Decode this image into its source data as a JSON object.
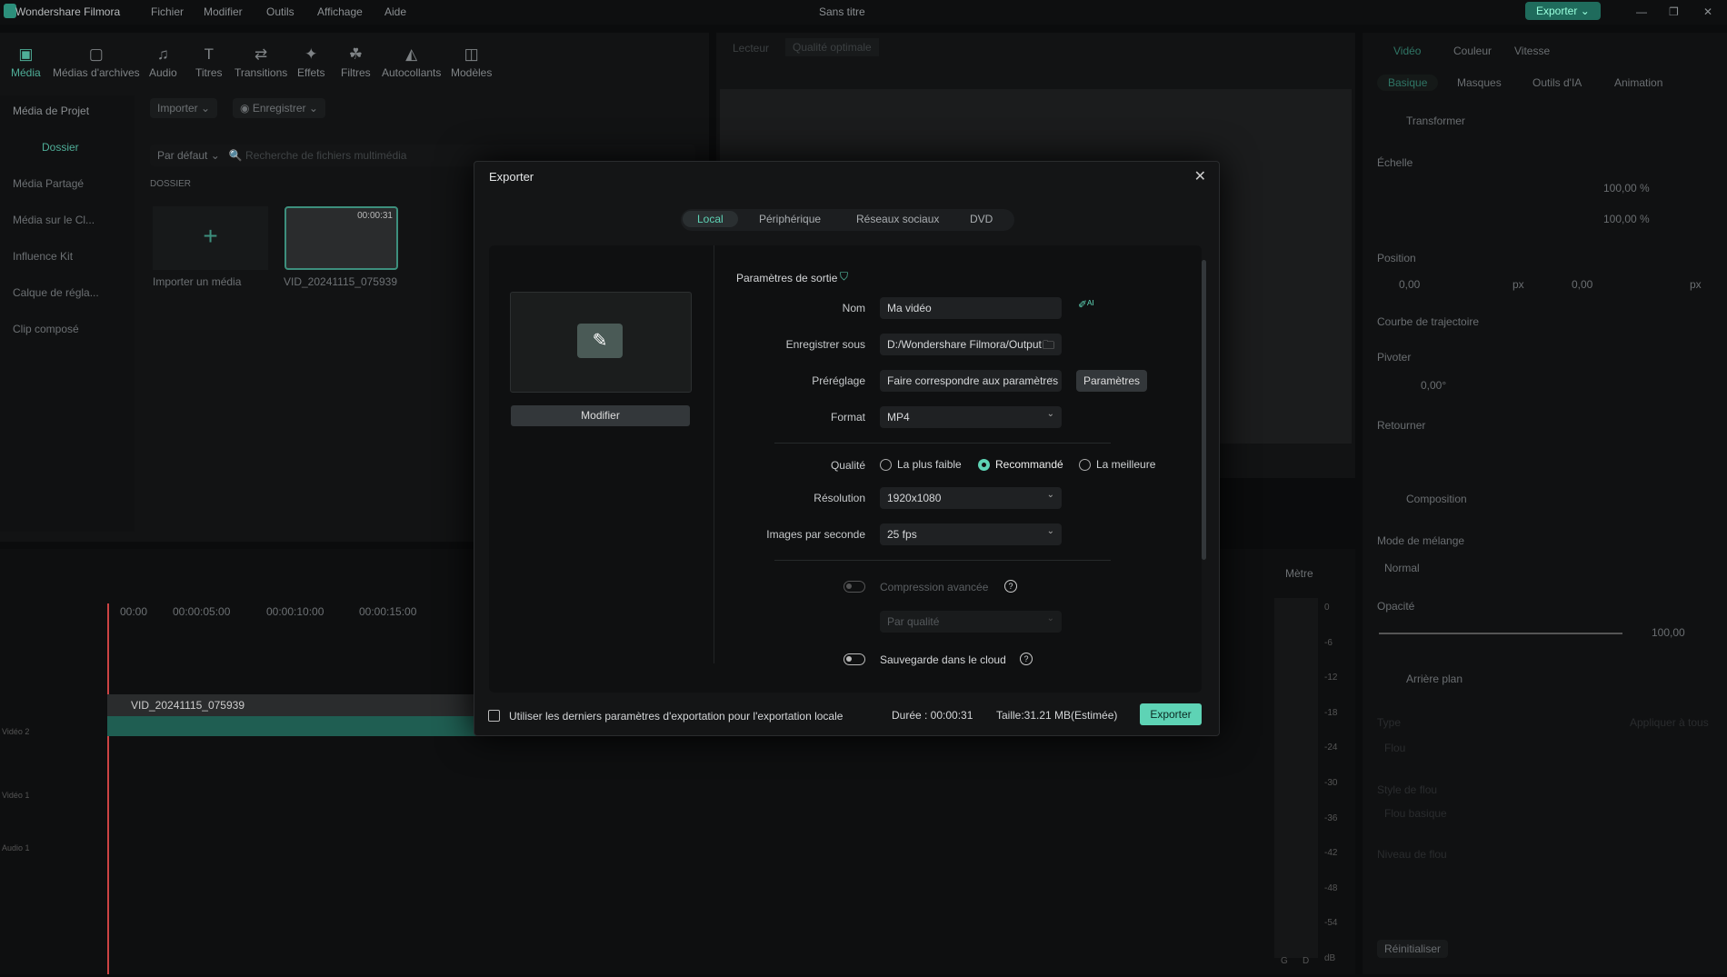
{
  "app": {
    "name": "Wondershare Filmora",
    "project": "Sans titre",
    "menu": [
      "Fichier",
      "Modifier",
      "Outils",
      "Affichage",
      "Aide"
    ],
    "export_label": "Exporter",
    "accent": "#5ed3b5"
  },
  "toolbar": [
    "Média",
    "Médias d'archives",
    "Audio",
    "Titres",
    "Transitions",
    "Effets",
    "Filtres",
    "Autocollants",
    "Modèles"
  ],
  "sidebar": [
    "Média de Projet",
    "Dossier",
    "Média Partagé",
    "Média sur le Cl...",
    "Influence Kit",
    "Calque de régla...",
    "Clip composé"
  ],
  "media": {
    "import": "Importer",
    "record": "Enregistrer",
    "sort": "Par défaut",
    "search_placeholder": "Recherche de fichiers multimédia",
    "folder": "DOSSIER",
    "import_tile": "Importer un média",
    "clip_name": "VID_20241115_075939",
    "clip_duration": "00:00:31"
  },
  "player": {
    "label": "Lecteur",
    "quality": "Qualité optimale"
  },
  "timeline": {
    "ruler": [
      "00:00",
      "00:00:05:00",
      "00:00:10:00",
      "00:00:15:00"
    ],
    "clip": "VID_20241115_075939",
    "tracks": [
      "Vidéo 2",
      "Vidéo 1",
      "Audio 1"
    ],
    "meter_label": "Mètre",
    "meter_ticks": [
      "0",
      "-6",
      "-12",
      "-18",
      "-24",
      "-30",
      "-36",
      "-42",
      "-48",
      "-54",
      "dB"
    ],
    "meter_channels": [
      "G",
      "D"
    ]
  },
  "right": {
    "tabs": [
      "Vidéo",
      "Couleur",
      "Vitesse"
    ],
    "subtabs": [
      "Basique",
      "Masques",
      "Outils d'IA",
      "Animation"
    ],
    "transform": "Transformer",
    "scale": "Échelle",
    "scale_x": "100,00",
    "scale_y": "100,00",
    "pct": "%",
    "position": "Position",
    "pos_x": "0,00",
    "pos_y": "0,00",
    "px": "px",
    "curve": "Courbe de trajectoire",
    "rotate": "Pivoter",
    "rotate_val": "0,00°",
    "flip": "Retourner",
    "composition": "Composition",
    "blend": "Mode de mélange",
    "blend_val": "Normal",
    "opacity": "Opacité",
    "opacity_val": "100,00",
    "background": "Arrière plan",
    "type": "Type",
    "apply_all": "Appliquer à tous",
    "type_val": "Flou",
    "blur_style": "Style de flou",
    "blur_style_val": "Flou basique",
    "blur_level": "Niveau de flou",
    "reset": "Réinitialiser"
  },
  "dialog": {
    "title": "Exporter",
    "tabs": [
      "Local",
      "Périphérique",
      "Réseaux sociaux",
      "DVD"
    ],
    "active_tab": "Local",
    "modify": "Modifier",
    "section": "Paramètres de sortie",
    "name_label": "Nom",
    "name_value": "Ma vidéo",
    "save_label": "Enregistrer sous",
    "save_value": "D:/Wondershare Filmora/Output",
    "preset_label": "Préréglage",
    "preset_value": "Faire correspondre aux paramètres",
    "params_button": "Paramètres",
    "format_label": "Format",
    "format_value": "MP4",
    "quality_label": "Qualité",
    "quality_options": [
      "La plus faible",
      "Recommandé",
      "La meilleure"
    ],
    "quality_selected": "Recommandé",
    "resolution_label": "Résolution",
    "resolution_value": "1920x1080",
    "fps_label": "Images par seconde",
    "fps_value": "25 fps",
    "compression_label": "Compression avancée",
    "compression_mode": "Par qualité",
    "cloud_label": "Sauvegarde dans le cloud",
    "use_last": "Utiliser les derniers paramètres d'exportation pour l'exportation locale",
    "duration": "Durée : 00:00:31",
    "size": "Taille:31.21 MB(Estimée)",
    "export_button": "Exporter"
  }
}
